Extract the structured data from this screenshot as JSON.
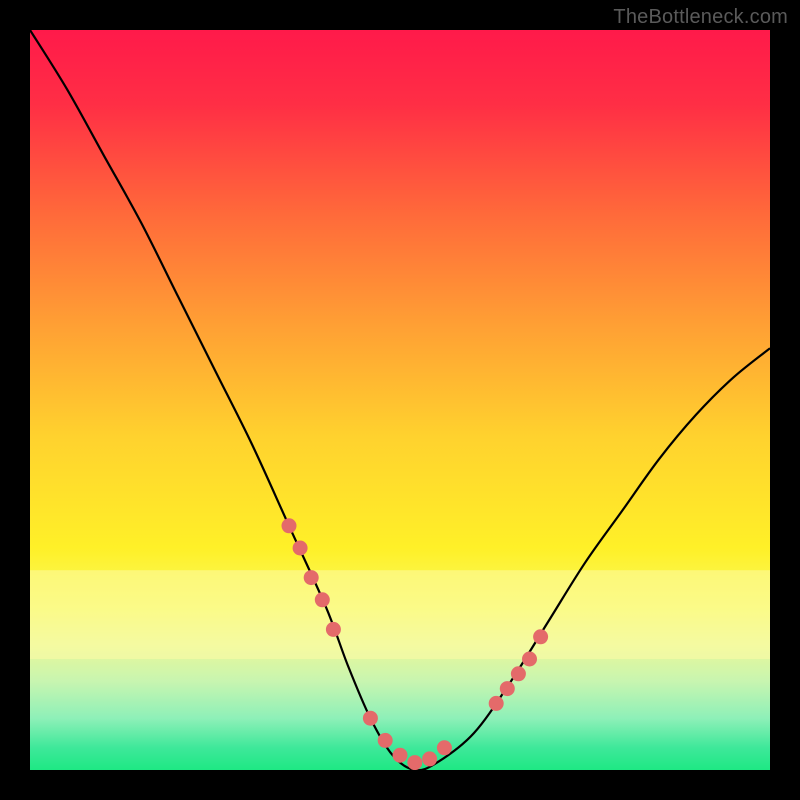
{
  "watermark": "TheBottleneck.com",
  "chart_data": {
    "type": "line",
    "title": "",
    "xlabel": "",
    "ylabel": "",
    "xlim": [
      0,
      100
    ],
    "ylim": [
      0,
      100
    ],
    "series": [
      {
        "name": "bottleneck-curve",
        "x": [
          0,
          5,
          10,
          15,
          20,
          25,
          30,
          35,
          40,
          43,
          46,
          49,
          52,
          55,
          60,
          65,
          70,
          75,
          80,
          85,
          90,
          95,
          100
        ],
        "y": [
          100,
          92,
          83,
          74,
          64,
          54,
          44,
          33,
          22,
          14,
          7,
          2,
          0,
          1,
          5,
          12,
          20,
          28,
          35,
          42,
          48,
          53,
          57
        ]
      }
    ],
    "markers": {
      "name": "highlight-dots",
      "color": "#e46a6a",
      "points_x": [
        35,
        36.5,
        38,
        39.5,
        41,
        46,
        48,
        50,
        52,
        54,
        56,
        63,
        64.5,
        66,
        67.5,
        69
      ],
      "points_y": [
        33,
        30,
        26,
        23,
        19,
        7,
        4,
        2,
        1,
        1.5,
        3,
        9,
        11,
        13,
        15,
        18
      ]
    },
    "gradient_stops": [
      {
        "offset": 0.0,
        "color": "#ff1a4a"
      },
      {
        "offset": 0.1,
        "color": "#ff2e45"
      },
      {
        "offset": 0.25,
        "color": "#ff6a3a"
      },
      {
        "offset": 0.4,
        "color": "#ffa034"
      },
      {
        "offset": 0.55,
        "color": "#ffd22e"
      },
      {
        "offset": 0.7,
        "color": "#fff028"
      },
      {
        "offset": 0.78,
        "color": "#f8fa60"
      },
      {
        "offset": 0.83,
        "color": "#eaf898"
      },
      {
        "offset": 0.88,
        "color": "#c8f5b0"
      },
      {
        "offset": 0.93,
        "color": "#8ef0b8"
      },
      {
        "offset": 0.97,
        "color": "#3ee89a"
      },
      {
        "offset": 1.0,
        "color": "#1ee884"
      }
    ],
    "yellow_band": {
      "y0": 0.73,
      "y1": 0.85,
      "color": "#fdfca8",
      "opacity": 0.55
    }
  }
}
